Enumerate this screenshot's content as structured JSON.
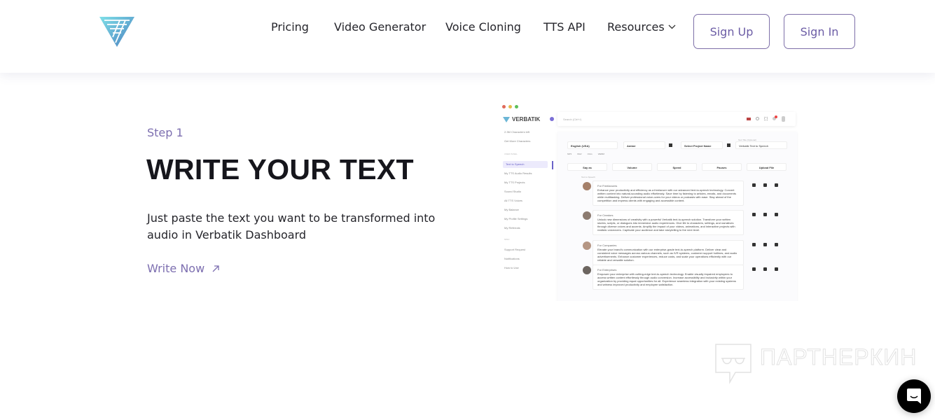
{
  "header": {
    "logo_name": "Verbatik",
    "nav": [
      {
        "label": "Pricing"
      },
      {
        "label": "Video Generator"
      },
      {
        "label": "Voice Cloning"
      },
      {
        "label": "TTS API"
      },
      {
        "label": "Resources",
        "icon": "chevron-down-icon"
      }
    ],
    "sign_up": "Sign Up",
    "sign_in": "Sign In"
  },
  "step": {
    "label": "Step 1",
    "title": "WRITE YOUR TEXT",
    "description": "Just paste the text you want to be transformed into audio in Verbatik Dashboard",
    "cta": "Write Now",
    "cta_icon": "arrow-up-right-icon"
  },
  "dashboard": {
    "brand": "VERBATIK",
    "search_placeholder": "Search (Ctrl+/)",
    "sidebar": [
      "2.3M Characters left",
      "Get More Characters",
      "USER PANEL",
      "Text to Speech",
      "My TTS Audio Results",
      "My TTS Projects",
      "Sound Studio",
      "All TTS Voices",
      "My Balance",
      "My Profile Settings",
      "My Referrals",
      "MISC",
      "Support Request",
      "Notifications",
      "How to Use"
    ],
    "language": "English (USA)",
    "voice": "Amber",
    "project": "Select Project Name",
    "title_label": "Text Title (Optional)",
    "title_value": "Verbatik Text to Speech",
    "formats": [
      "MP3",
      "WAV",
      "OGG",
      "WEBM"
    ],
    "controls": [
      "Say as",
      "Volume",
      "Speed",
      "Pauses",
      "Upload File"
    ],
    "section_label": "Text to Speech",
    "rows": [
      {
        "heading": "For Freelancers",
        "text": "Enhance your productivity and efficiency as a freelancer with our advanced text-to-speech technology. Convert written content into natural-sounding audio effortlessly. Save time by listening to articles, emails, and documents while multitasking. Deliver professional voice-overs for your videos or podcasts with ease. Stay ahead of the competition and impress clients with engaging and accessible content."
      },
      {
        "heading": "For Creators",
        "text": "Unlock new dimensions of creativity with a powerful Verbatik text-to-speech solution. Transform your written stories, scripts, or dialogues into immersive audio experiences. Give life to characters, settings, and narratives through diverse voices and accents. Amplify the impact of your videos, animations, and interactive projects with realistic voiceovers. Captivate your audience and take storytelling to the next level."
      },
      {
        "heading": "For Companies",
        "text": "Elevate your brand's communication with our enterprise-grade text-to-speech platform. Deliver clear and consistent voice messages across various channels, such as IVR systems, customer support hotlines, and audio advertisements. Enhance customer experiences, reduce costs, and scale your operations efficiently with our reliable and versatile solution."
      },
      {
        "heading": "For Enterprises",
        "text": "Empower your enterprise with cutting-edge text-to-speech technology. Enable visually impaired employees to access written content effortlessly through audio conversion. Increase accessibility and inclusivity within your organization by providing equal opportunities for all. Experience seamless integration with your existing systems and witness improved productivity and employee satisfaction."
      }
    ]
  },
  "watermark": "ПАРТНЕРКИН",
  "colors": {
    "accent": "#7d6fb0",
    "text": "#1c1c22",
    "button_border": "#7d6fa8"
  }
}
